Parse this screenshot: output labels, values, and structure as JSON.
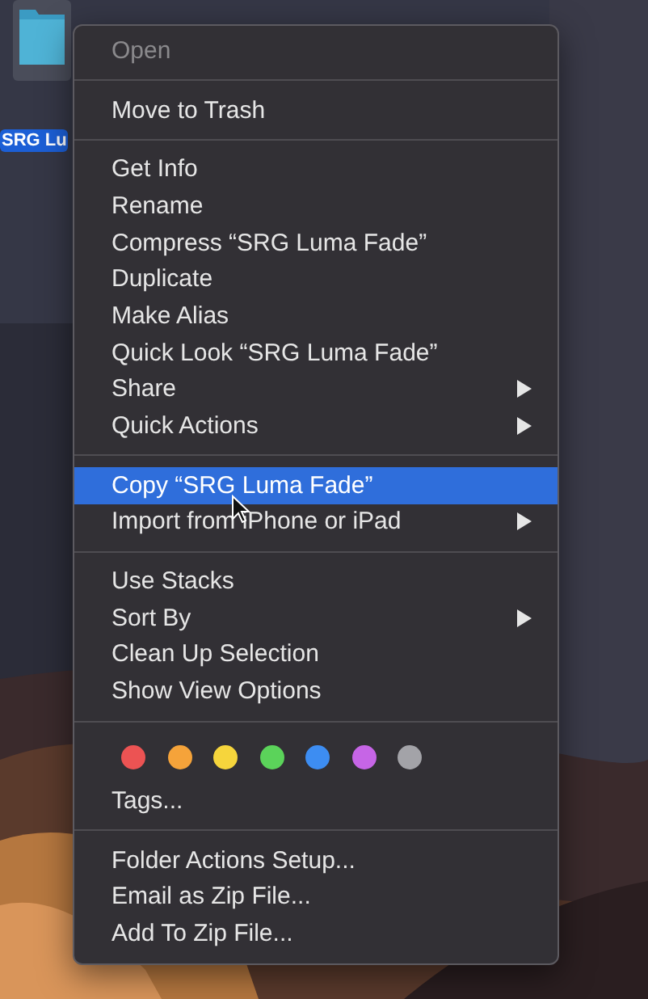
{
  "desktop": {
    "icon_label": "SRG Lu",
    "icon_selected": true
  },
  "menu": {
    "sections": [
      {
        "items": [
          {
            "kind": "command",
            "label": "Open",
            "disabled": true,
            "selected": false,
            "submenu": false
          }
        ]
      },
      {
        "items": [
          {
            "kind": "command",
            "label": "Move to Trash",
            "disabled": false,
            "selected": false,
            "submenu": false
          }
        ]
      },
      {
        "items": [
          {
            "kind": "command",
            "label": "Get Info",
            "disabled": false,
            "selected": false,
            "submenu": false
          },
          {
            "kind": "command",
            "label": "Rename",
            "disabled": false,
            "selected": false,
            "submenu": false
          },
          {
            "kind": "command",
            "label": "Compress “SRG Luma Fade”",
            "disabled": false,
            "selected": false,
            "submenu": false
          },
          {
            "kind": "command",
            "label": "Duplicate",
            "disabled": false,
            "selected": false,
            "submenu": false
          },
          {
            "kind": "command",
            "label": "Make Alias",
            "disabled": false,
            "selected": false,
            "submenu": false
          },
          {
            "kind": "command",
            "label": "Quick Look “SRG Luma Fade”",
            "disabled": false,
            "selected": false,
            "submenu": false
          },
          {
            "kind": "command",
            "label": "Share",
            "disabled": false,
            "selected": false,
            "submenu": true
          },
          {
            "kind": "command",
            "label": "Quick Actions",
            "disabled": false,
            "selected": false,
            "submenu": true
          }
        ]
      },
      {
        "items": [
          {
            "kind": "command",
            "label": "Copy “SRG Luma Fade”",
            "disabled": false,
            "selected": true,
            "submenu": false
          },
          {
            "kind": "command",
            "label": "Import from iPhone or iPad",
            "disabled": false,
            "selected": false,
            "submenu": true
          }
        ]
      },
      {
        "items": [
          {
            "kind": "command",
            "label": "Use Stacks",
            "disabled": false,
            "selected": false,
            "submenu": false
          },
          {
            "kind": "command",
            "label": "Sort By",
            "disabled": false,
            "selected": false,
            "submenu": true
          },
          {
            "kind": "command",
            "label": "Clean Up Selection",
            "disabled": false,
            "selected": false,
            "submenu": false
          },
          {
            "kind": "command",
            "label": "Show View Options",
            "disabled": false,
            "selected": false,
            "submenu": false
          }
        ]
      },
      {
        "items": [
          {
            "kind": "tag_colors",
            "tags": [
              {
                "color": "#ec5353"
              },
              {
                "color": "#f5a33a"
              },
              {
                "color": "#f6d53c"
              },
              {
                "color": "#5bd35a"
              },
              {
                "color": "#3d8df2"
              },
              {
                "color": "#c665e6"
              },
              {
                "color": "#a3a3a8"
              }
            ]
          },
          {
            "kind": "command",
            "label": "Tags...",
            "disabled": false,
            "selected": false,
            "submenu": false
          }
        ]
      },
      {
        "items": [
          {
            "kind": "command",
            "label": "Folder Actions Setup...",
            "disabled": false,
            "selected": false,
            "submenu": false
          },
          {
            "kind": "command",
            "label": "Email as Zip File...",
            "disabled": false,
            "selected": false,
            "submenu": false
          },
          {
            "kind": "command",
            "label": "Add To Zip File...",
            "disabled": false,
            "selected": false,
            "submenu": false
          }
        ]
      }
    ]
  }
}
